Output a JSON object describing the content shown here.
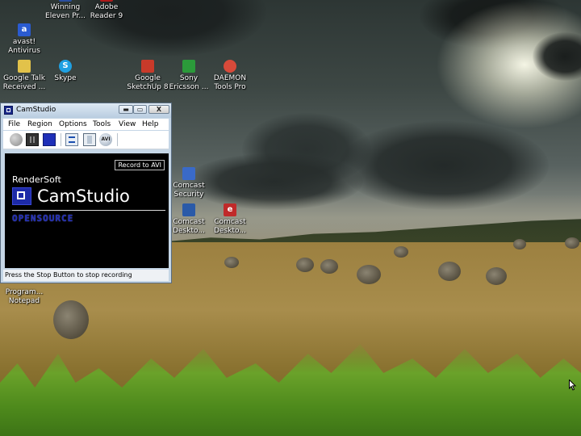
{
  "desktop": {
    "icons": [
      {
        "label": "Winning Eleven Pr...",
        "icon": "game-icon",
        "color": "#2a4fa0"
      },
      {
        "label": "Adobe Reader 9",
        "icon": "pdf-icon",
        "color": "#b01a1a"
      },
      {
        "label": "avast! Antivirus",
        "icon": "antivirus-icon",
        "color": "#2a5bd0"
      },
      {
        "label": "Google Talk Received ...",
        "icon": "folder-icon",
        "color": "#e2c24a"
      },
      {
        "label": "Skype",
        "icon": "skype-icon",
        "color": "#1fa0e2"
      },
      {
        "label": "Google SketchUp 8",
        "icon": "sketchup-icon",
        "color": "#c83a2a"
      },
      {
        "label": "Sony Ericsson ...",
        "icon": "phone-icon",
        "color": "#2b9a3a"
      },
      {
        "label": "DAEMON Tools Pro",
        "icon": "disc-icon",
        "color": "#d84a3a"
      },
      {
        "label": "Comcast Security",
        "icon": "security-icon",
        "color": "#3a6ac8"
      },
      {
        "label": "Comcast Deskto...",
        "icon": "comcast-icon",
        "color": "#2a5aa8"
      },
      {
        "label": "Comcast Deskto...",
        "icon": "comcast-icon",
        "color": "#c02a2a"
      },
      {
        "label": "Program... Notepad",
        "icon": "notepad-icon",
        "color": "#6a8ab0"
      }
    ]
  },
  "window": {
    "title": "CamStudio",
    "controls": {
      "minimize": "▬",
      "maximize": "▭",
      "close": "X"
    },
    "menu": [
      "File",
      "Region",
      "Options",
      "Tools",
      "View",
      "Help"
    ],
    "toolbar": {
      "buttons": [
        "record-icon",
        "pause-icon",
        "stop-icon",
        "options-icon",
        "annotation-icon",
        "avi-icon"
      ],
      "avi_glyph": "AVI"
    },
    "viewport": {
      "record_button": "Record to AVI",
      "brand_small": "RenderSoft",
      "brand_big": "CamStudio",
      "brand_os": "OPENSOURCE"
    },
    "status": "Press the Stop Button to stop recording"
  }
}
